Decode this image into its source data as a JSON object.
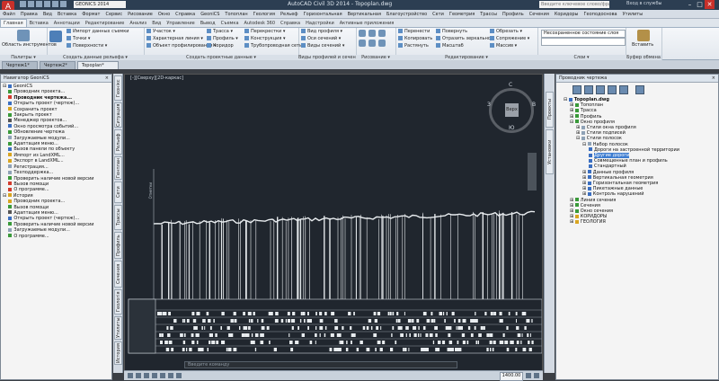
{
  "titlebar": {
    "workspace": "GEONICS 2014",
    "title": "AutoCAD Civil 3D 2014 - Topoplan.dwg",
    "search_placeholder": "Введите ключевое слово/фразу",
    "signin": "Вход в службы",
    "min": "–",
    "max": "□",
    "close": "✕"
  },
  "menu": [
    "Файл",
    "Правка",
    "Вид",
    "Вставка",
    "Формат",
    "Сервис",
    "Рисование",
    "Окно",
    "Справка",
    "GeoniCS",
    "Топоплан",
    "Геология",
    "Рельеф",
    "Горизонтальная",
    "Вертикальная",
    "Благоустройство",
    "Сети",
    "Геометрия",
    "Трассы",
    "Профиль",
    "Сечения",
    "Коридоры",
    "Геоподоснова",
    "Утилиты"
  ],
  "ribbon_tabs": [
    "Главная",
    "Вставка",
    "Аннотации",
    "Редактирование",
    "Анализ",
    "Вид",
    "Управление",
    "Вывод",
    "Съемка",
    "Autodesk 360",
    "Справка",
    "Надстройки",
    "Активные приложения"
  ],
  "ribbon": {
    "palettes": {
      "label": "Область инструментов",
      "title": "Палитры ▾"
    },
    "ground": {
      "items": [
        "Импорт данных съемки",
        "Точки ▾",
        "Поверхности ▾"
      ],
      "title": "Создать данные рельефа ▾"
    },
    "design": {
      "items": [
        "Участок ▾",
        "Характерная линия ▾",
        "Объект профилирования ▾",
        "Трасса ▾",
        "Профиль ▾",
        "Коридор",
        "Перекрестки ▾",
        "Конструкция ▾",
        "Трубопроводная сеть ▾"
      ],
      "title": "Создать проектные данные ▾"
    },
    "profile_views": {
      "items": [
        "Вид профиля ▾",
        "Оси сечений ▾",
        "Виды сечений ▾"
      ],
      "title": "Виды профилей и сечений"
    },
    "draw": {
      "title": "Рисование ▾"
    },
    "modify": {
      "items": [
        "Перенести",
        "Копировать",
        "Растянуть",
        "Повернуть",
        "Отразить зеркально",
        "Масштаб",
        "Обрезать ▾",
        "Сопряжение ▾",
        "Массив ▾"
      ],
      "title": "Редактирование ▾"
    },
    "layers": {
      "state": "Несохраненное состояние слоя",
      "title": "Слои ▾"
    },
    "clipboard": {
      "paste": "Вставить",
      "title": "Буфер обмена"
    }
  },
  "doc_tabs": [
    "Чертеж1*",
    "Чертеж2*",
    "Topoplan*"
  ],
  "navigator": {
    "header": "Навигатор GeoniCS",
    "root": "GeoniCS",
    "project_items": [
      "Проводник проекта...",
      "Проводник чертежа...",
      "Открыть проект (чертеж)...",
      "Сохранить проект",
      "Закрыть проект",
      "Менеджер проектов...",
      "Окно просмотра событий...",
      "Обновление чертежа",
      "Загружаемые модули...",
      "Адаптация меню...",
      "Вызов панели по объекту",
      "Импорт из LandXML...",
      "Экспорт в LandXML...",
      "Регистрация...",
      "Техподдержка...",
      "Проверить наличие новой версии",
      "Вызов помощи",
      "О программе..."
    ],
    "history_root": "История",
    "history_items": [
      "Проводник проекта...",
      "Вызов помощи",
      "Адаптация меню...",
      "Открыть проект (чертеж)...",
      "Проверить наличие новой версии",
      "Загружаемые модули...",
      "О программе..."
    ]
  },
  "left_vtabs": [
    "Геонікс",
    "Ситуация",
    "Рельеф",
    "Генплан",
    "Сети",
    "Трассы",
    "Профиль",
    "Сечения",
    "Геологія",
    "Утилиты",
    "История"
  ],
  "canvas": {
    "view_label": "[-][Сверху][2D-каркас]",
    "cube_face": "Верх",
    "dir_n": "С",
    "dir_s": "Ю",
    "dir_w": "З",
    "dir_e": "В",
    "y_axis_label": "Отметки",
    "command_placeholder": "Введите команду",
    "scale": "1400.00"
  },
  "right_vtabs": [
    "Проекты",
    "Установки"
  ],
  "drawing_explorer": {
    "header": "Проводник чертежа",
    "root": "Topoplan.dwg",
    "items": [
      {
        "t": "Топоплан",
        "lvl": 1,
        "ic": "g"
      },
      {
        "t": "Трасса",
        "lvl": 1,
        "ic": "g"
      },
      {
        "t": "Профиль",
        "lvl": 1,
        "ic": "g"
      },
      {
        "t": "Окно профиля",
        "lvl": 1,
        "ic": "g"
      },
      {
        "t": "Стили окна профиля",
        "lvl": 2,
        "ic": "s"
      },
      {
        "t": "Стили подписей",
        "lvl": 2,
        "ic": "s"
      },
      {
        "t": "Стили полосок",
        "lvl": 2,
        "ic": "s"
      },
      {
        "t": "Набор полосок",
        "lvl": 3,
        "ic": "s"
      },
      {
        "t": "Дороги на застроенной территории",
        "lvl": 4,
        "ic": "b"
      },
      {
        "t": "Другие дороги",
        "lvl": 4,
        "ic": "b",
        "sel": true
      },
      {
        "t": "Совмещенные план и профиль",
        "lvl": 4,
        "ic": "b"
      },
      {
        "t": "Стандартный",
        "lvl": 4,
        "ic": "b"
      },
      {
        "t": "Данные профиля",
        "lvl": 3,
        "ic": "b"
      },
      {
        "t": "Вертикальная геометрия",
        "lvl": 3,
        "ic": "b"
      },
      {
        "t": "Горизонтальная геометрия",
        "lvl": 3,
        "ic": "b"
      },
      {
        "t": "Пикетажные данные",
        "lvl": 3,
        "ic": "b"
      },
      {
        "t": "Контроль нарушений",
        "lvl": 3,
        "ic": "b"
      },
      {
        "t": "Линия сечения",
        "lvl": 1,
        "ic": "g"
      },
      {
        "t": "Сечения",
        "lvl": 1,
        "ic": "g"
      },
      {
        "t": "Окно сечения",
        "lvl": 1,
        "ic": "g"
      },
      {
        "t": "КОРИДОРЫ",
        "lvl": 1,
        "ic": "y"
      },
      {
        "t": "ГЕОЛОГИЯ",
        "lvl": 1,
        "ic": "y"
      }
    ]
  }
}
